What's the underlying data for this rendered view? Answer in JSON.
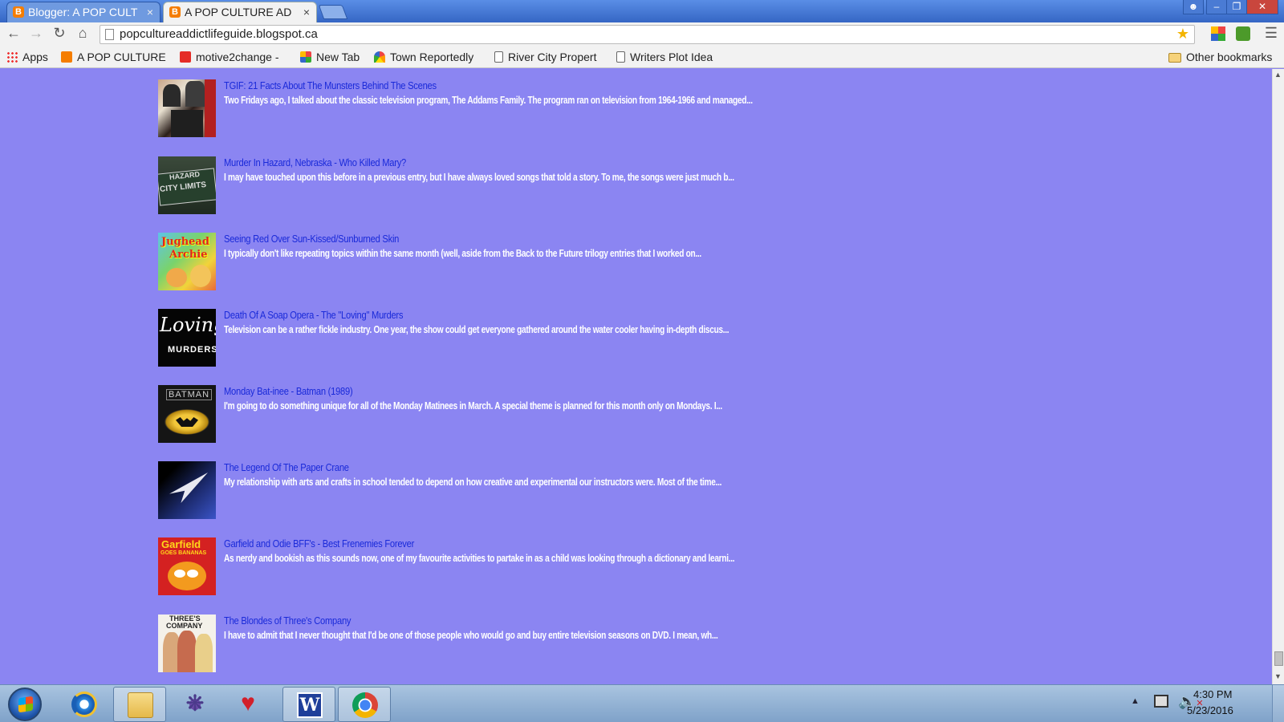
{
  "browser": {
    "tabs": [
      {
        "title": "Blogger: A POP CULT",
        "active": false
      },
      {
        "title": "A POP CULTURE AD",
        "active": true
      }
    ],
    "address": "popcultureaddictlifeguide.blogspot.ca",
    "bookmarks": [
      {
        "label": "Apps"
      },
      {
        "label": "A POP CULTURE A"
      },
      {
        "label": "motive2change -"
      },
      {
        "label": "New Tab"
      },
      {
        "label": "Town Reportedly"
      },
      {
        "label": "River City Propert"
      },
      {
        "label": "Writers Plot Idea"
      }
    ],
    "other_bookmarks": "Other bookmarks"
  },
  "posts": [
    {
      "title": "TGIF: 21 Facts About The Munsters Behind The Scenes",
      "snippet": "Two Fridays ago, I talked about the classic television program, The Addams Family. The program ran on television from 1964-1966 and managed...",
      "thumb": "munsters-photo"
    },
    {
      "title": "Murder In Hazard, Nebraska - Who Killed Mary?",
      "snippet": "I may have touched upon this before in a previous entry, but I have always loved songs that told a story. To me, the songs were just much b...",
      "thumb": "hazard-city-limits-sign",
      "thumb_text": [
        "HAZARD",
        "CITY LIMITS"
      ]
    },
    {
      "title": "Seeing Red Over Sun-Kissed/Sunburned Skin",
      "snippet": "I typically don't like repeating topics within the same month (well, aside from the Back to the Future trilogy entries that I worked on...",
      "thumb": "jughead-archie-comic",
      "thumb_text": [
        "Jughead",
        "Archie"
      ]
    },
    {
      "title": "Death Of A Soap Opera - The \"Loving\" Murders",
      "snippet": "Television can be a rather fickle industry. One year, the show could get everyone gathered around the water cooler having in-depth discus...",
      "thumb": "loving-murders-logo",
      "thumb_text": [
        "Loving",
        "MURDERS"
      ]
    },
    {
      "title": "Monday Bat-inee - Batman (1989)",
      "snippet": "I'm going to do something unique for all of the Monday Matinees in March.   A special theme is planned for this month only on Mondays.   I...",
      "thumb": "batman-1989-poster",
      "thumb_text": [
        "BATMAN"
      ]
    },
    {
      "title": "The Legend Of The Paper Crane",
      "snippet": "My relationship with arts and crafts in school tended to depend on how creative and experimental our instructors were. Most of the time...",
      "thumb": "paper-plane-image"
    },
    {
      "title": "Garfield and Odie BFF's - Best Frenemies Forever",
      "snippet": "As nerdy and bookish as this sounds now, one of my favourite activities to partake in as a child was looking through a dictionary and learni...",
      "thumb": "garfield-goes-bananas-cover",
      "thumb_text": [
        "Garfield",
        "GOES BANANAS"
      ]
    },
    {
      "title": "The Blondes of Three's Company",
      "snippet": "I have to admit that I never thought that I'd be one of those people who would go and buy entire television seasons on DVD. I mean, wh...",
      "thumb": "threes-company-dvd-cover",
      "thumb_text": [
        "THREE'S",
        "COMPANY"
      ]
    }
  ],
  "taskbar": {
    "apps": [
      "internet-explorer-icon",
      "file-explorer-icon",
      "spider-solitaire-icon",
      "hearts-game-icon",
      "word-icon",
      "chrome-icon"
    ],
    "clock_time": "4:30 PM",
    "clock_date": "5/23/2016"
  },
  "colors": {
    "page_background": "#8b85f2",
    "post_title": "#1a2ad9",
    "post_snippet": "#ffffff"
  }
}
